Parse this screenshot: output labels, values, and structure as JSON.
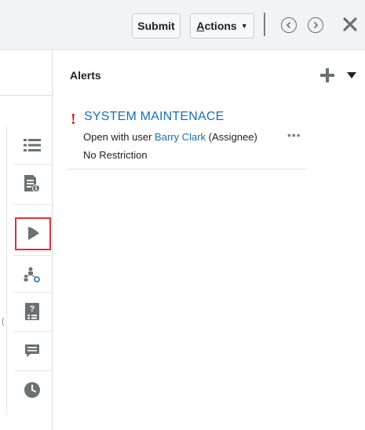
{
  "toolbar": {
    "submit_label": "Submit",
    "actions_label": "Actions",
    "actions_accesskey_letter": "A",
    "actions_rest": "ctions"
  },
  "rail": {
    "items": [
      {
        "name": "list-icon"
      },
      {
        "name": "document-info-icon"
      },
      {
        "name": "bell-icon",
        "active": true
      },
      {
        "name": "workflow-users-icon"
      },
      {
        "name": "help-checklist-icon"
      },
      {
        "name": "comment-icon"
      },
      {
        "name": "history-clock-icon"
      }
    ],
    "highlight_color": "#e0303a"
  },
  "left_fragment": "(",
  "alerts": {
    "title": "Alerts",
    "items": [
      {
        "marker": "!",
        "title": "SYSTEM MAINTENACE",
        "line1_prefix": "Open with user ",
        "user": "Barry Clark",
        "line1_suffix": " (Assignee)",
        "restriction": "No Restriction",
        "more": "•••"
      }
    ]
  },
  "colors": {
    "link": "#1a6fb0",
    "alert_marker": "#d71920",
    "toolbar_bg": "#f1f3f5"
  }
}
